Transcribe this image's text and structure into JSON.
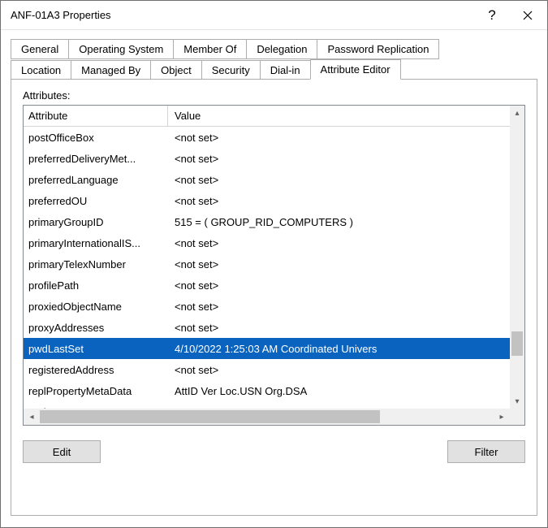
{
  "window": {
    "title": "ANF-01A3 Properties"
  },
  "tabs": {
    "row1": [
      {
        "label": "General"
      },
      {
        "label": "Operating System"
      },
      {
        "label": "Member Of"
      },
      {
        "label": "Delegation"
      },
      {
        "label": "Password Replication"
      }
    ],
    "row2": [
      {
        "label": "Location"
      },
      {
        "label": "Managed By"
      },
      {
        "label": "Object"
      },
      {
        "label": "Security"
      },
      {
        "label": "Dial-in"
      },
      {
        "label": "Attribute Editor",
        "active": true
      }
    ]
  },
  "attributesLabel": "Attributes:",
  "columns": {
    "attribute": "Attribute",
    "value": "Value"
  },
  "rows": [
    {
      "attr": "postOfficeBox",
      "val": "<not set>"
    },
    {
      "attr": "preferredDeliveryMet...",
      "val": "<not set>"
    },
    {
      "attr": "preferredLanguage",
      "val": "<not set>"
    },
    {
      "attr": "preferredOU",
      "val": "<not set>"
    },
    {
      "attr": "primaryGroupID",
      "val": "515 = ( GROUP_RID_COMPUTERS )"
    },
    {
      "attr": "primaryInternationalIS...",
      "val": "<not set>"
    },
    {
      "attr": "primaryTelexNumber",
      "val": "<not set>"
    },
    {
      "attr": "profilePath",
      "val": "<not set>"
    },
    {
      "attr": "proxiedObjectName",
      "val": "<not set>"
    },
    {
      "attr": "proxyAddresses",
      "val": "<not set>"
    },
    {
      "attr": "pwdLastSet",
      "val": "4/10/2022 1:25:03 AM Coordinated Univers",
      "selected": true
    },
    {
      "attr": "registeredAddress",
      "val": "<not set>"
    },
    {
      "attr": "replPropertyMetaData",
      "val": " AttID  Ver     Loc.USN               Org.DSA"
    },
    {
      "attr": "replUpToDateVector",
      "val": "<not set>"
    }
  ],
  "buttons": {
    "edit": "Edit",
    "filter": "Filter"
  }
}
